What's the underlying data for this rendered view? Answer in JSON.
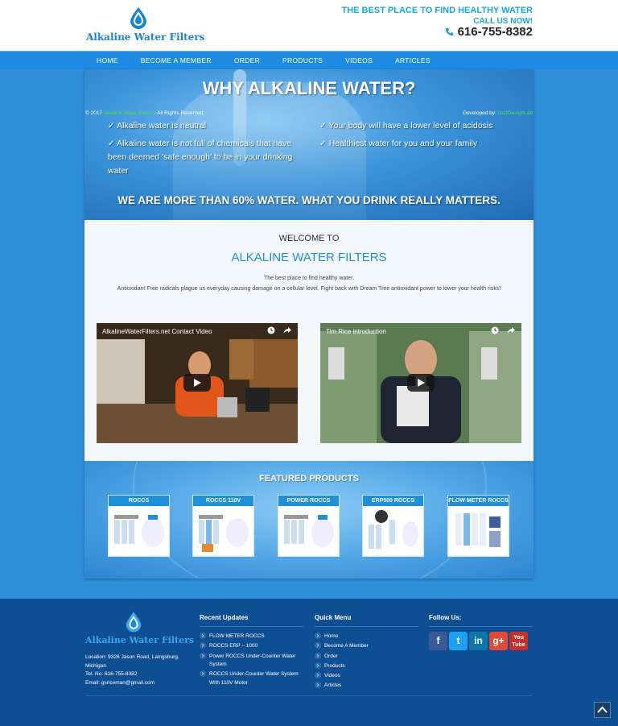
{
  "header": {
    "brand": "Alkaline Water Filters",
    "tagline": "THE BEST PLACE TO FIND HEALTHY WATER",
    "call_label": "CALL US NOW!",
    "phone": "616-755-8382"
  },
  "nav": [
    "HOME",
    "BECOME A MEMBER",
    "ORDER",
    "PRODUCTS",
    "VIDEOS",
    "ARTICLES"
  ],
  "hero": {
    "title": "WHY ALKALINE WATER?",
    "benefits_left": [
      "✓ Alkaline water is neutral",
      "✓ Alkaline water is not full of chemicals that have been deemed 'safe enough' to be in your drinking water"
    ],
    "benefits_right": [
      "✓ Your body will have a lower level of acidosis",
      "✓ Healthiest water for you and your family"
    ],
    "bottom": "WE ARE MORE THAN 60% WATER. WHAT YOU DRINK REALLY MATTERS."
  },
  "welcome": {
    "label": "WELCOME TO",
    "title": "ALKALINE WATER FILTERS",
    "line1": "The best place to find healthy water.",
    "line2": "Antioxidant Free radicals plague us everyday causing damage on a cellular level. Fight back with Dream Tree antioxidant power to lower your health risks!"
  },
  "videos": [
    {
      "title": "AlkalineWaterFilters.net Contact Video"
    },
    {
      "title": "Tim Rice introduction"
    }
  ],
  "featured": {
    "title": "FEATURED PRODUCTS",
    "products": [
      "ROCCS",
      "ROCCS 110V",
      "POWER ROCCS",
      "ERP500 ROCCS",
      "FLOW METER ROCCS"
    ]
  },
  "footer": {
    "brand": "Alkaline Water Filters",
    "address": "Location: 9326 Jason Road, Laingsburg, Michigan",
    "tel": "Tel. No: 616-755-8382",
    "email": "Email: gsriceman@gmail.com",
    "recent_title": "Recent Updates",
    "recent": [
      "FLOW METER ROCCS",
      "ROCCS ERP – 1000",
      "Power ROCCS Under-Counter Water System",
      "ROCCS Under-Counter Water System With 110V Motor"
    ],
    "quick_title": "Quick Menu",
    "quick": [
      "Home",
      "Become A Member",
      "Order",
      "Products",
      "Videos",
      "Articles"
    ],
    "follow_title": "Follow Us:",
    "social": [
      {
        "name": "facebook",
        "glyph": "f",
        "color": "#3b5998"
      },
      {
        "name": "twitter",
        "glyph": "t",
        "color": "#1da1f2"
      },
      {
        "name": "linkedin",
        "glyph": "in",
        "color": "#0e76a8"
      },
      {
        "name": "google-plus",
        "glyph": "g+",
        "color": "#dd4b39"
      },
      {
        "name": "youtube",
        "glyph": "You Tube",
        "color": "#c4302b"
      }
    ],
    "copyright_prefix": "© 2017",
    "copyright_brand": "Alkaline Water Filters",
    "copyright_suffix": "- All Rights Reserved.",
    "dev_label": "Developed by:",
    "dev_name": "Go2DesignLab"
  }
}
